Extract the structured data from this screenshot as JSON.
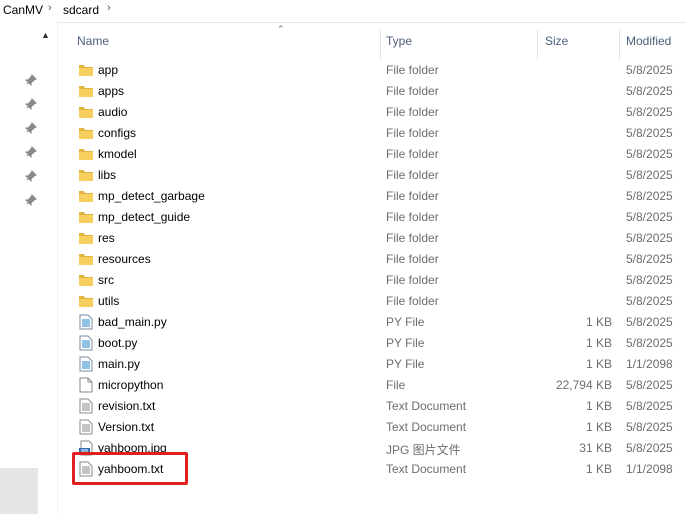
{
  "breadcrumb": {
    "items": [
      "CanMV",
      "sdcard"
    ]
  },
  "columns": {
    "name": "Name",
    "type": "Type",
    "size": "Size",
    "modified": "Modified"
  },
  "rows": [
    {
      "name": "app",
      "type": "File folder",
      "size": "",
      "modified": "5/8/2025",
      "icon": "folder-icon"
    },
    {
      "name": "apps",
      "type": "File folder",
      "size": "",
      "modified": "5/8/2025",
      "icon": "folder-icon"
    },
    {
      "name": "audio",
      "type": "File folder",
      "size": "",
      "modified": "5/8/2025",
      "icon": "folder-icon"
    },
    {
      "name": "configs",
      "type": "File folder",
      "size": "",
      "modified": "5/8/2025",
      "icon": "folder-icon"
    },
    {
      "name": "kmodel",
      "type": "File folder",
      "size": "",
      "modified": "5/8/2025",
      "icon": "folder-icon"
    },
    {
      "name": "libs",
      "type": "File folder",
      "size": "",
      "modified": "5/8/2025",
      "icon": "folder-icon"
    },
    {
      "name": "mp_detect_garbage",
      "type": "File folder",
      "size": "",
      "modified": "5/8/2025",
      "icon": "folder-icon"
    },
    {
      "name": "mp_detect_guide",
      "type": "File folder",
      "size": "",
      "modified": "5/8/2025",
      "icon": "folder-icon"
    },
    {
      "name": "res",
      "type": "File folder",
      "size": "",
      "modified": "5/8/2025",
      "icon": "folder-icon"
    },
    {
      "name": "resources",
      "type": "File folder",
      "size": "",
      "modified": "5/8/2025",
      "icon": "folder-icon"
    },
    {
      "name": "src",
      "type": "File folder",
      "size": "",
      "modified": "5/8/2025",
      "icon": "folder-icon"
    },
    {
      "name": "utils",
      "type": "File folder",
      "size": "",
      "modified": "5/8/2025",
      "icon": "folder-icon"
    },
    {
      "name": "bad_main.py",
      "type": "PY File",
      "size": "1 KB",
      "modified": "5/8/2025",
      "icon": "python-file-icon"
    },
    {
      "name": "boot.py",
      "type": "PY File",
      "size": "1 KB",
      "modified": "5/8/2025",
      "icon": "python-file-icon"
    },
    {
      "name": "main.py",
      "type": "PY File",
      "size": "1 KB",
      "modified": "1/1/2098",
      "icon": "python-file-icon"
    },
    {
      "name": "micropython",
      "type": "File",
      "size": "22,794 KB",
      "modified": "5/8/2025",
      "icon": "blank-file-icon"
    },
    {
      "name": "revision.txt",
      "type": "Text Document",
      "size": "1 KB",
      "modified": "5/8/2025",
      "icon": "text-file-icon"
    },
    {
      "name": "Version.txt",
      "type": "Text Document",
      "size": "1 KB",
      "modified": "5/8/2025",
      "icon": "text-file-icon"
    },
    {
      "name": "yahboom.jpg",
      "type": "JPG 图片文件",
      "size": "31 KB",
      "modified": "5/8/2025",
      "icon": "jpg-file-icon"
    },
    {
      "name": "yahboom.txt",
      "type": "Text Document",
      "size": "1 KB",
      "modified": "1/1/2098",
      "icon": "text-file-icon"
    }
  ],
  "colors": {
    "folder": "#f6cf5e",
    "folderDark": "#e3b341",
    "pyBlue": "#8fc3e6",
    "header": "#4c607a",
    "highlight": "#e02020"
  }
}
